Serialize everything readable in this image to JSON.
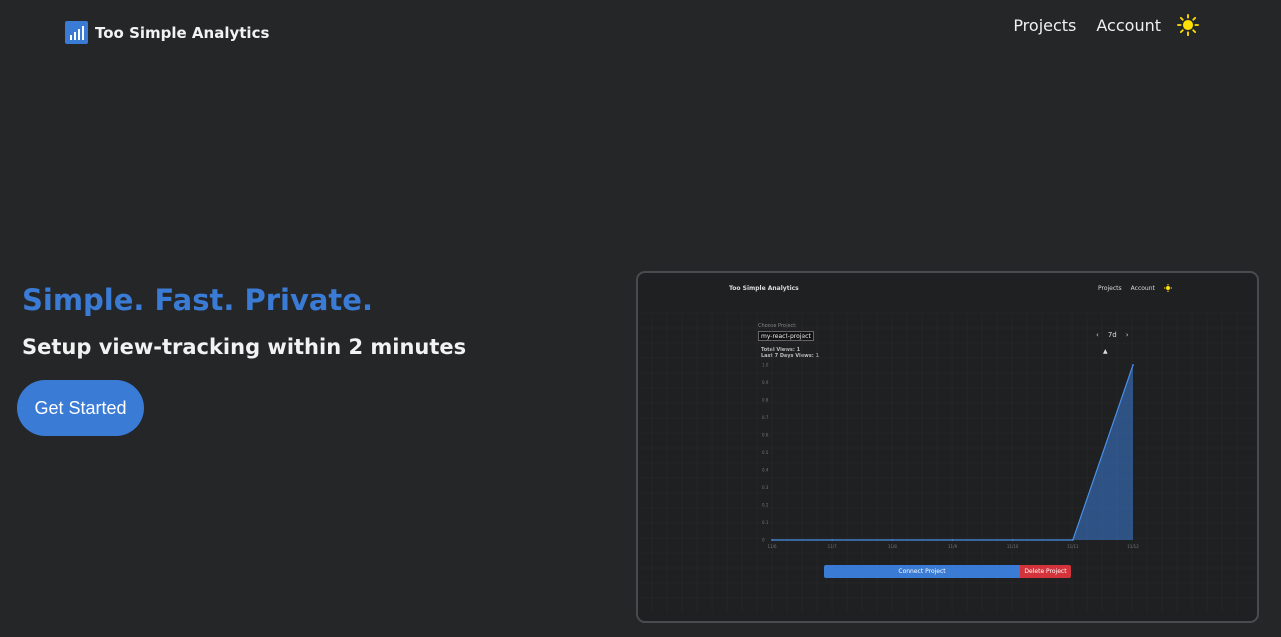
{
  "nav": {
    "brand": "Too Simple Analytics",
    "links": [
      "Projects",
      "Account"
    ],
    "theme_icon": "sun-icon"
  },
  "hero": {
    "title": "Simple. Fast. Private.",
    "subtitle": "Setup view-tracking within 2 minutes",
    "cta_label": "Get Started"
  },
  "preview": {
    "brand": "Too Simple Analytics",
    "nav_links": [
      "Projects",
      "Account"
    ],
    "choose_label": "Choose Project:",
    "project_selected": "my-react-project",
    "total_views": "Total Views: 1",
    "last7_views": "Last 7 Days Views: 1",
    "range_prev": "‹",
    "range_label": "7d",
    "range_next": "›",
    "connect_label": "Connect Project",
    "delete_label": "Delete Project"
  },
  "colors": {
    "accent": "#3a7bd5",
    "danger": "#d3343b",
    "background": "#252628",
    "sun": "#ffe100"
  },
  "chart_data": {
    "type": "area",
    "categories": [
      "11/6",
      "11/7",
      "11/8",
      "11/9",
      "11/10",
      "11/11",
      "11/12"
    ],
    "values": [
      0,
      0,
      0,
      0,
      0,
      0,
      1
    ],
    "yticks": [
      "1.0",
      "0.9",
      "0.8",
      "0.7",
      "0.6",
      "0.5",
      "0.4",
      "0.3",
      "0.2",
      "0.1",
      "0"
    ],
    "ylim": [
      0,
      1
    ],
    "grid": true
  }
}
